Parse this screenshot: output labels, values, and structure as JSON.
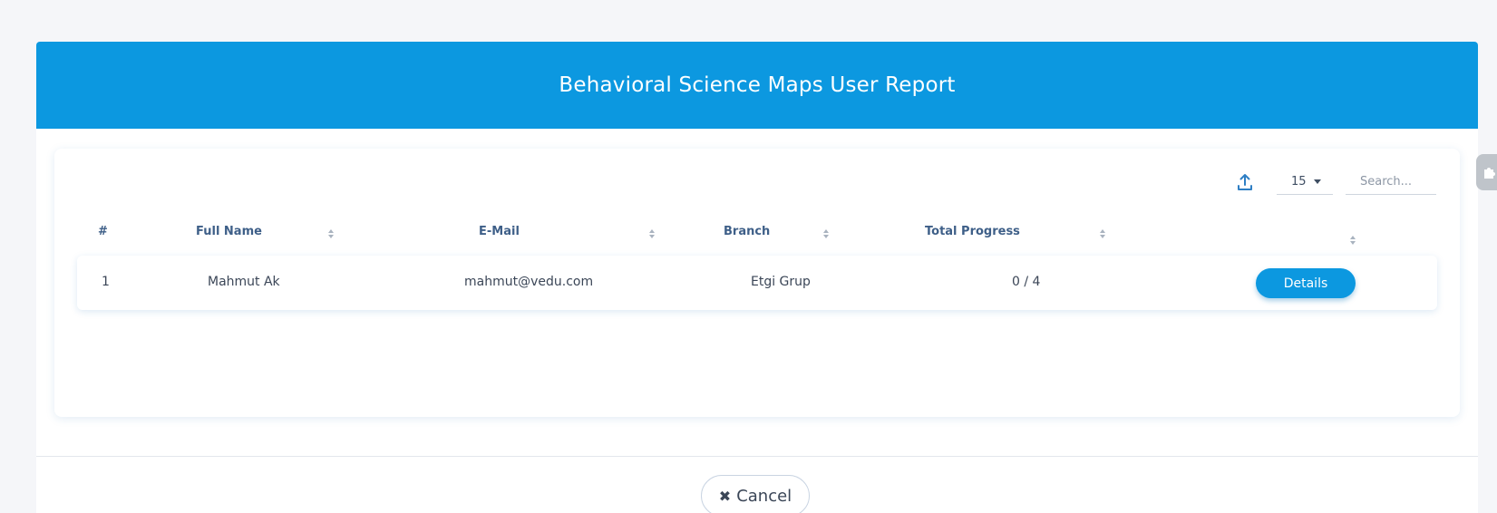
{
  "modal": {
    "title": "Behavioral Science Maps User Report"
  },
  "toolbar": {
    "export_icon": "upload-icon",
    "page_size": "15",
    "search_placeholder": "Search..."
  },
  "table": {
    "columns": [
      "#",
      "Full Name",
      "E-Mail",
      "Branch",
      "Total Progress",
      ""
    ],
    "rows": [
      {
        "index": "1",
        "full_name": "Mahmut Ak",
        "email": "mahmut@vedu.com",
        "branch": "Etgi Grup",
        "total_progress": "0 / 4",
        "action_label": "Details"
      }
    ]
  },
  "footer": {
    "cancel_label": "Cancel",
    "cancel_icon": "close-icon"
  },
  "colors": {
    "header_bg": "#0c98e0",
    "header_text": "#ffffff",
    "column_header_text": "#3e5f88",
    "body_text": "#3b4657",
    "button_bg": "#0c98e0",
    "page_bg": "#f5f6f9"
  }
}
